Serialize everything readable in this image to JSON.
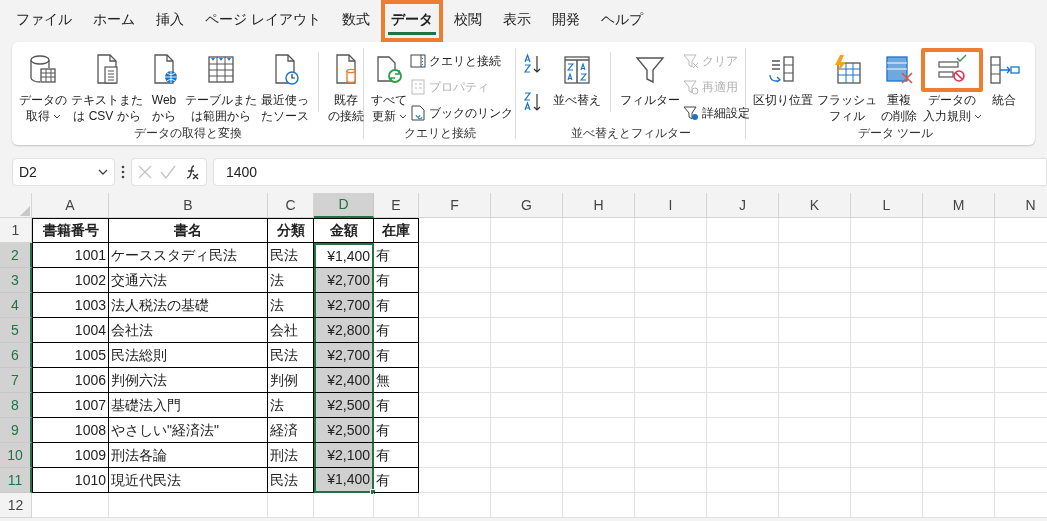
{
  "tabs": [
    {
      "label": "ファイル",
      "selected": false,
      "highlighted": false
    },
    {
      "label": "ホーム",
      "selected": false,
      "highlighted": false
    },
    {
      "label": "挿入",
      "selected": false,
      "highlighted": false
    },
    {
      "label": "ページ レイアウト",
      "selected": false,
      "highlighted": false
    },
    {
      "label": "数式",
      "selected": false,
      "highlighted": false
    },
    {
      "label": "データ",
      "selected": true,
      "highlighted": true
    },
    {
      "label": "校閲",
      "selected": false,
      "highlighted": false
    },
    {
      "label": "表示",
      "selected": false,
      "highlighted": false
    },
    {
      "label": "開発",
      "selected": false,
      "highlighted": false
    },
    {
      "label": "ヘルプ",
      "selected": false,
      "highlighted": false
    }
  ],
  "ribbon": {
    "groups": [
      {
        "label": "データの取得と変換",
        "items": [
          {
            "kind": "large",
            "lines": [
              "データの",
              "取得"
            ],
            "dropdown": true
          },
          {
            "kind": "large",
            "lines": [
              "テキストまた",
              "は CSV から"
            ],
            "dropdown": false
          },
          {
            "kind": "large",
            "lines": [
              "Web",
              "から"
            ],
            "dropdown": false
          },
          {
            "kind": "large",
            "lines": [
              "テーブルまた",
              "は範囲から"
            ],
            "dropdown": false
          },
          {
            "kind": "large",
            "lines": [
              "最近使っ",
              "たソース"
            ],
            "dropdown": false
          },
          {
            "kind": "separator"
          },
          {
            "kind": "large",
            "lines": [
              "既存",
              "の接続"
            ],
            "dropdown": false
          }
        ]
      },
      {
        "label": "クエリと接続",
        "items": [
          {
            "kind": "large",
            "lines": [
              "すべて",
              "更新"
            ],
            "dropdown": true
          },
          {
            "kind": "small",
            "entries": [
              {
                "label": "クエリと接続",
                "disabled": false
              },
              {
                "label": "プロパティ",
                "disabled": true
              },
              {
                "label": "ブックのリンク",
                "disabled": false
              }
            ]
          }
        ]
      },
      {
        "label": "並べ替えとフィルター",
        "items": [
          {
            "kind": "sort"
          },
          {
            "kind": "large",
            "lines": [
              "並べ替え"
            ],
            "dropdown": false
          },
          {
            "kind": "separator"
          },
          {
            "kind": "large",
            "lines": [
              "フィルター"
            ],
            "dropdown": false
          },
          {
            "kind": "small",
            "entries": [
              {
                "label": "クリア",
                "disabled": true
              },
              {
                "label": "再適用",
                "disabled": true
              },
              {
                "label": "詳細設定",
                "disabled": false
              }
            ]
          }
        ]
      },
      {
        "label": "データ ツール",
        "items": [
          {
            "kind": "large",
            "lines": [
              "区切り位置"
            ],
            "dropdown": false
          },
          {
            "kind": "large",
            "lines": [
              "フラッシュ",
              "フィル"
            ],
            "dropdown": false
          },
          {
            "kind": "large",
            "lines": [
              "重複",
              "の削除"
            ],
            "dropdown": false
          },
          {
            "kind": "large",
            "lines": [
              "データの",
              "入力規則"
            ],
            "dropdown": true,
            "highlighted": true
          },
          {
            "kind": "large",
            "lines": [
              "統合"
            ],
            "dropdown": false
          }
        ]
      }
    ]
  },
  "name_box": "D2",
  "formula": "1400",
  "columns": [
    {
      "label": "A",
      "selected": false
    },
    {
      "label": "B",
      "selected": false
    },
    {
      "label": "C",
      "selected": false
    },
    {
      "label": "D",
      "selected": true
    },
    {
      "label": "E",
      "selected": false
    },
    {
      "label": "F",
      "selected": false
    },
    {
      "label": "G",
      "selected": false
    },
    {
      "label": "H",
      "selected": false
    },
    {
      "label": "I",
      "selected": false
    },
    {
      "label": "J",
      "selected": false
    },
    {
      "label": "K",
      "selected": false
    },
    {
      "label": "L",
      "selected": false
    },
    {
      "label": "M",
      "selected": false
    },
    {
      "label": "N",
      "selected": false
    }
  ],
  "rows": [
    {
      "number": "1",
      "selected": false,
      "cells": [
        "書籍番号",
        "書名",
        "分類",
        "金額",
        "在庫"
      ]
    },
    {
      "number": "2",
      "selected": true,
      "active": true,
      "cells": [
        "1001",
        "ケーススタディ民法",
        "民法",
        "¥1,400",
        "有"
      ]
    },
    {
      "number": "3",
      "selected": true,
      "active": false,
      "cells": [
        "1002",
        "交通六法",
        "法",
        "¥2,700",
        "有"
      ]
    },
    {
      "number": "4",
      "selected": true,
      "active": false,
      "cells": [
        "1003",
        "法人税法の基礎",
        "法",
        "¥2,700",
        "有"
      ]
    },
    {
      "number": "5",
      "selected": true,
      "active": false,
      "cells": [
        "1004",
        "会社法",
        "会社",
        "¥2,800",
        "有"
      ]
    },
    {
      "number": "6",
      "selected": true,
      "active": false,
      "cells": [
        "1005",
        "民法総則",
        "民法",
        "¥2,700",
        "有"
      ]
    },
    {
      "number": "7",
      "selected": true,
      "active": false,
      "cells": [
        "1006",
        "判例六法",
        "判例",
        "¥2,400",
        "無"
      ]
    },
    {
      "number": "8",
      "selected": true,
      "active": false,
      "cells": [
        "1007",
        "基礎法入門",
        "法",
        "¥2,500",
        "有"
      ]
    },
    {
      "number": "9",
      "selected": true,
      "active": false,
      "cells": [
        "1008",
        "やさしい\"経済法\"",
        "経済",
        "¥2,500",
        "有"
      ]
    },
    {
      "number": "10",
      "selected": true,
      "active": false,
      "cells": [
        "1009",
        "刑法各論",
        "刑法",
        "¥2,100",
        "有"
      ]
    },
    {
      "number": "11",
      "selected": true,
      "active": false,
      "cells": [
        "1010",
        "現近代民法",
        "民法",
        "¥1,400",
        "有"
      ]
    },
    {
      "number": "12",
      "selected": false,
      "cells": []
    }
  ]
}
